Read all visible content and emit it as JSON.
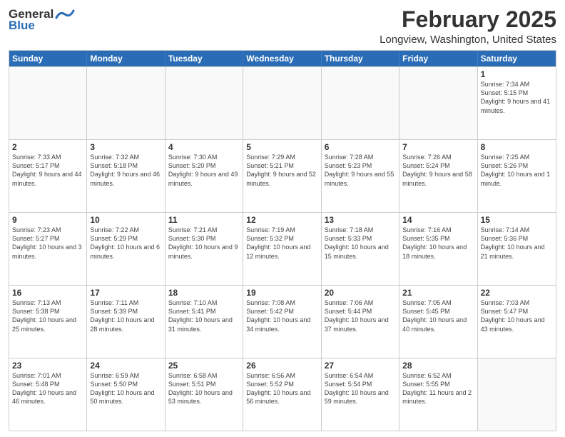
{
  "logo": {
    "line1": "General",
    "line2": "Blue"
  },
  "title": "February 2025",
  "subtitle": "Longview, Washington, United States",
  "header_days": [
    "Sunday",
    "Monday",
    "Tuesday",
    "Wednesday",
    "Thursday",
    "Friday",
    "Saturday"
  ],
  "weeks": [
    [
      {
        "day": "",
        "info": ""
      },
      {
        "day": "",
        "info": ""
      },
      {
        "day": "",
        "info": ""
      },
      {
        "day": "",
        "info": ""
      },
      {
        "day": "",
        "info": ""
      },
      {
        "day": "",
        "info": ""
      },
      {
        "day": "1",
        "info": "Sunrise: 7:34 AM\nSunset: 5:15 PM\nDaylight: 9 hours and 41 minutes."
      }
    ],
    [
      {
        "day": "2",
        "info": "Sunrise: 7:33 AM\nSunset: 5:17 PM\nDaylight: 9 hours and 44 minutes."
      },
      {
        "day": "3",
        "info": "Sunrise: 7:32 AM\nSunset: 5:18 PM\nDaylight: 9 hours and 46 minutes."
      },
      {
        "day": "4",
        "info": "Sunrise: 7:30 AM\nSunset: 5:20 PM\nDaylight: 9 hours and 49 minutes."
      },
      {
        "day": "5",
        "info": "Sunrise: 7:29 AM\nSunset: 5:21 PM\nDaylight: 9 hours and 52 minutes."
      },
      {
        "day": "6",
        "info": "Sunrise: 7:28 AM\nSunset: 5:23 PM\nDaylight: 9 hours and 55 minutes."
      },
      {
        "day": "7",
        "info": "Sunrise: 7:26 AM\nSunset: 5:24 PM\nDaylight: 9 hours and 58 minutes."
      },
      {
        "day": "8",
        "info": "Sunrise: 7:25 AM\nSunset: 5:26 PM\nDaylight: 10 hours and 1 minute."
      }
    ],
    [
      {
        "day": "9",
        "info": "Sunrise: 7:23 AM\nSunset: 5:27 PM\nDaylight: 10 hours and 3 minutes."
      },
      {
        "day": "10",
        "info": "Sunrise: 7:22 AM\nSunset: 5:29 PM\nDaylight: 10 hours and 6 minutes."
      },
      {
        "day": "11",
        "info": "Sunrise: 7:21 AM\nSunset: 5:30 PM\nDaylight: 10 hours and 9 minutes."
      },
      {
        "day": "12",
        "info": "Sunrise: 7:19 AM\nSunset: 5:32 PM\nDaylight: 10 hours and 12 minutes."
      },
      {
        "day": "13",
        "info": "Sunrise: 7:18 AM\nSunset: 5:33 PM\nDaylight: 10 hours and 15 minutes."
      },
      {
        "day": "14",
        "info": "Sunrise: 7:16 AM\nSunset: 5:35 PM\nDaylight: 10 hours and 18 minutes."
      },
      {
        "day": "15",
        "info": "Sunrise: 7:14 AM\nSunset: 5:36 PM\nDaylight: 10 hours and 21 minutes."
      }
    ],
    [
      {
        "day": "16",
        "info": "Sunrise: 7:13 AM\nSunset: 5:38 PM\nDaylight: 10 hours and 25 minutes."
      },
      {
        "day": "17",
        "info": "Sunrise: 7:11 AM\nSunset: 5:39 PM\nDaylight: 10 hours and 28 minutes."
      },
      {
        "day": "18",
        "info": "Sunrise: 7:10 AM\nSunset: 5:41 PM\nDaylight: 10 hours and 31 minutes."
      },
      {
        "day": "19",
        "info": "Sunrise: 7:08 AM\nSunset: 5:42 PM\nDaylight: 10 hours and 34 minutes."
      },
      {
        "day": "20",
        "info": "Sunrise: 7:06 AM\nSunset: 5:44 PM\nDaylight: 10 hours and 37 minutes."
      },
      {
        "day": "21",
        "info": "Sunrise: 7:05 AM\nSunset: 5:45 PM\nDaylight: 10 hours and 40 minutes."
      },
      {
        "day": "22",
        "info": "Sunrise: 7:03 AM\nSunset: 5:47 PM\nDaylight: 10 hours and 43 minutes."
      }
    ],
    [
      {
        "day": "23",
        "info": "Sunrise: 7:01 AM\nSunset: 5:48 PM\nDaylight: 10 hours and 46 minutes."
      },
      {
        "day": "24",
        "info": "Sunrise: 6:59 AM\nSunset: 5:50 PM\nDaylight: 10 hours and 50 minutes."
      },
      {
        "day": "25",
        "info": "Sunrise: 6:58 AM\nSunset: 5:51 PM\nDaylight: 10 hours and 53 minutes."
      },
      {
        "day": "26",
        "info": "Sunrise: 6:56 AM\nSunset: 5:52 PM\nDaylight: 10 hours and 56 minutes."
      },
      {
        "day": "27",
        "info": "Sunrise: 6:54 AM\nSunset: 5:54 PM\nDaylight: 10 hours and 59 minutes."
      },
      {
        "day": "28",
        "info": "Sunrise: 6:52 AM\nSunset: 5:55 PM\nDaylight: 11 hours and 2 minutes."
      },
      {
        "day": "",
        "info": ""
      }
    ]
  ]
}
